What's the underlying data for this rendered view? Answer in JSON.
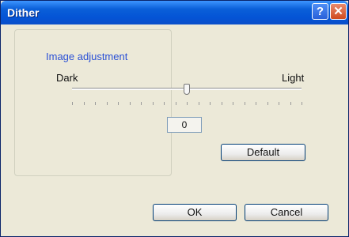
{
  "window": {
    "title": "Dither",
    "help_symbol": "?",
    "close_symbol": "✕"
  },
  "group": {
    "label": "Image adjustment",
    "min_label": "Dark",
    "max_label": "Light",
    "slider_position": 0.5,
    "tick_count": 21,
    "value": "0",
    "default_label": "Default"
  },
  "buttons": {
    "ok": "OK",
    "cancel": "Cancel"
  }
}
